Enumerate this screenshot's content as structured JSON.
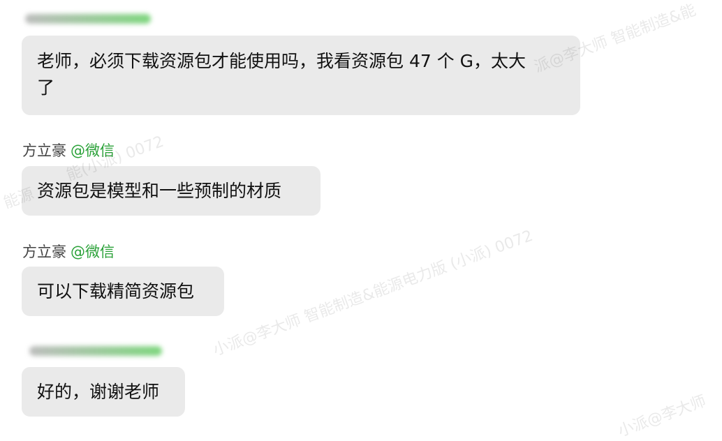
{
  "colors": {
    "bubble": "#eaeaea",
    "sender_name": "#444444",
    "handle": "#2aa138",
    "blur_gradient_start": "#bdbdbd",
    "blur_gradient_end": "#7ed67e"
  },
  "messages": [
    {
      "sender_blurred": true,
      "text": "老师，必须下载资源包才能使用吗，我看资源包 47 个 G，太大\n了"
    },
    {
      "sender": "方立豪",
      "handle": "@微信",
      "text": "资源包是模型和一些预制的材质"
    },
    {
      "sender": "方立豪",
      "handle": "@微信",
      "text": "可以下载精简资源包"
    },
    {
      "sender_blurred": true,
      "text": "好的，谢谢老师"
    }
  ],
  "watermarks": [
    "小派@李大师 智能制造&能源电力版 (小派) 0072",
    "派@李大师 智能制造&能",
    "小派@李大师",
    "能源",
    "能(小派) 0072"
  ]
}
